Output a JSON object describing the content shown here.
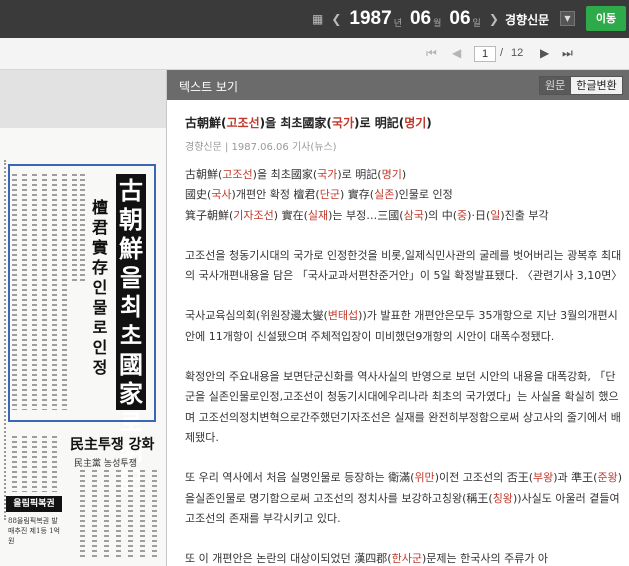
{
  "topbar": {
    "prev_icon": "chevron-left-icon",
    "year": "1987",
    "year_unit": "년",
    "month": "06",
    "month_unit": "월",
    "day": "06",
    "day_unit": "일",
    "next_icon": "chevron-right-icon",
    "newspaper": "경향신문",
    "move_label": "이동"
  },
  "pagebar": {
    "current_page": "1",
    "separator": "/",
    "total_pages": "12"
  },
  "scan": {
    "headline": "古朝鮮을 최초國家로 明記",
    "subheadline": "檀君 實存인물로 인정",
    "second_headline": "民主투쟁 강화",
    "second_sub": "民主黨 농성투쟁",
    "box_label": "올림픽복권",
    "small_text": "88올림픽복권 발매추진 제1등 1억원"
  },
  "panel": {
    "title": "텍스트 보기",
    "tab_original": "원문",
    "tab_hangul": "한글변환",
    "article": {
      "title_parts": [
        "古朝鮮(",
        "고조선",
        ")을 최초國家(",
        "국가",
        ")로 明記(",
        "명기",
        ")"
      ],
      "meta": "경향신문 | 1987.06.06 기사(뉴스)",
      "lead_1_parts": [
        "古朝鮮(",
        "고조선",
        ")을 최초國家(",
        "국가",
        ")로 明記(",
        "명기",
        ")"
      ],
      "lead_2_parts": [
        "國史(",
        "국사",
        ")개편안 확정 檀君(",
        "단군",
        ") 實存(",
        "실존",
        ")인물로 인정"
      ],
      "lead_3_parts": [
        "箕子朝鮮(",
        "기자조선",
        ") 實在(",
        "실재",
        ")는 부정…三國(",
        "삼국",
        ")의 中(",
        "중",
        ")·日(",
        "일",
        ")진출 부각"
      ],
      "para1": " 고조선을 청동기시대의 국가로 인정한것을 비롯,일제식민사관의 굴레를 벗어버리는 광복후 최대의 국사개편내용을 담은 「국사교과서편찬준거안」이 5일 확정발표됐다. 〈관련기사 3,10면〉",
      "para2_parts": [
        " 국사교육심의회(위원장邊太燮(",
        "변태섭",
        "))가 발표한 개편안은모두 35개항으로 지난 3월의개편시안에 11개항이 신설됐으며 주체적입장이 미비했던9개항의 시안이 대폭수정됐다."
      ],
      "para3": " 확정안의 주요내용을 보면단군신화를 역사사실의 반영으로 보던 시안의 내용을 대폭강화, 「단군을 실존인물로인정,고조선이 청동기시대에우리나라 최초의 국가였다」는 사실을 확실히 했으며 고조선의정치변혁으로간주했던기자조선은 실재를 완전히부정함으로써 상고사의 줄기에서 배제됐다.",
      "para4_parts": [
        " 또 우리 역사에서 처음 실명인물로 등장하는 衛滿(",
        "위만",
        ")이전 고조선의 否王(",
        "부왕",
        ")과 準王(",
        "준왕",
        ")을실존인물로 명기함으로써 고조선의 정치사를 보강하고칭왕(稱王(",
        "칭왕",
        "))사실도 아울러 곁들여 고조선의 존재를 부각시키고 있다."
      ],
      "para5_parts": [
        " 또 이 개편안은 논란의 대상이되었던 漢四郡(",
        "한사군",
        ")문제는 한국사의 주류가 아"
      ]
    }
  }
}
